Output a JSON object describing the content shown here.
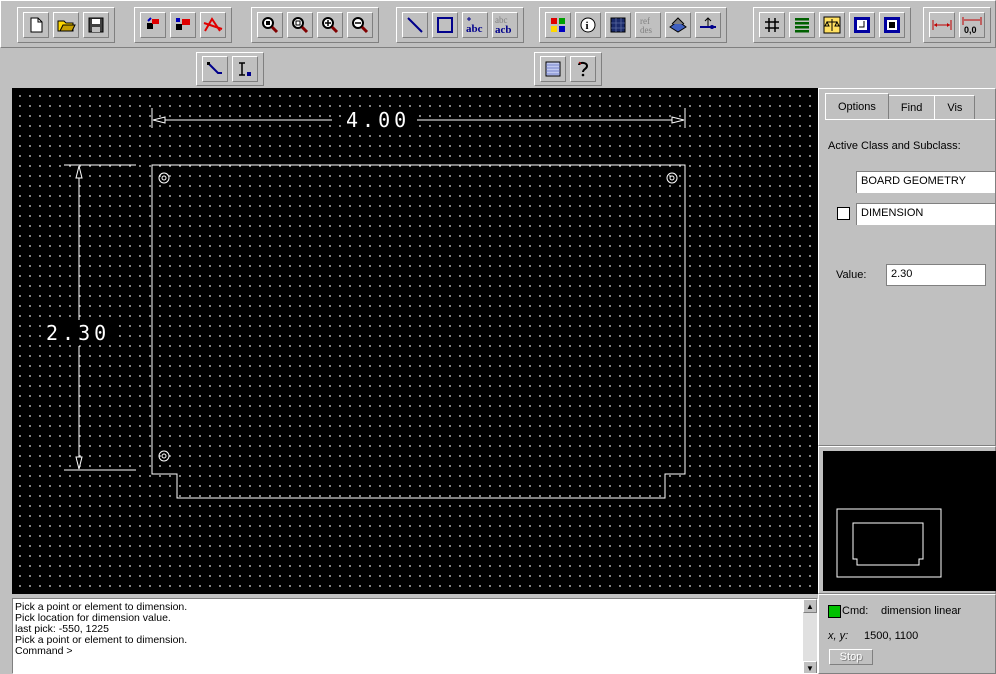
{
  "toolbar_main": {
    "icons": [
      "new-file-icon",
      "open-folder-icon",
      "save-icon",
      "move-icon",
      "copy-icon",
      "delete-icon",
      "zoom-window-icon",
      "zoom-fit-icon",
      "zoom-in-icon",
      "zoom-out-icon",
      "add-line-icon",
      "add-rectangle-icon",
      "add-text-icon",
      "edit-text-icon",
      "color-icon",
      "info-icon",
      "shape-fill-icon",
      "ref-des-icon",
      "layer-stack-icon",
      "via-icon",
      "grid-icon",
      "layers-icon",
      "balance-icon",
      "place-icon",
      "chip-icon",
      "dimension-linear-icon",
      "dimension-datum-icon"
    ],
    "ref_label_top": "ref",
    "ref_label_bottom": "des",
    "abc_label": "abc",
    "acb_label": "acb",
    "datum_label": "0,0"
  },
  "toolbar_secondary": {
    "icons": [
      "route-icon",
      "text-cursor-icon",
      "pattern-icon",
      "help-icon"
    ]
  },
  "canvas": {
    "horizontal_dimension": "4.00",
    "vertical_dimension": "2.30",
    "colors": {
      "background": "#000000",
      "outline": "#ffffff",
      "grid": "#a8a8a8"
    }
  },
  "options_panel": {
    "tabs": [
      "Options",
      "Find",
      "Vis"
    ],
    "active_tab": "Options",
    "class_subclass_label": "Active Class and Subclass:",
    "class_value": "BOARD GEOMETRY",
    "subclass_value": "DIMENSION",
    "value_label": "Value:",
    "value": "2.30"
  },
  "console": {
    "lines": [
      "Pick a point or element to dimension.",
      "Pick location for dimension value.",
      "last pick:  -550, 1225",
      "Pick a point or element to dimension.",
      "Command >"
    ]
  },
  "status": {
    "cmd_label": "Cmd:",
    "cmd_value": "dimension linear",
    "xy_label": "x, y:",
    "xy_value": "1500, 1100",
    "stop_label": "Stop",
    "led_color": "#00c000"
  }
}
